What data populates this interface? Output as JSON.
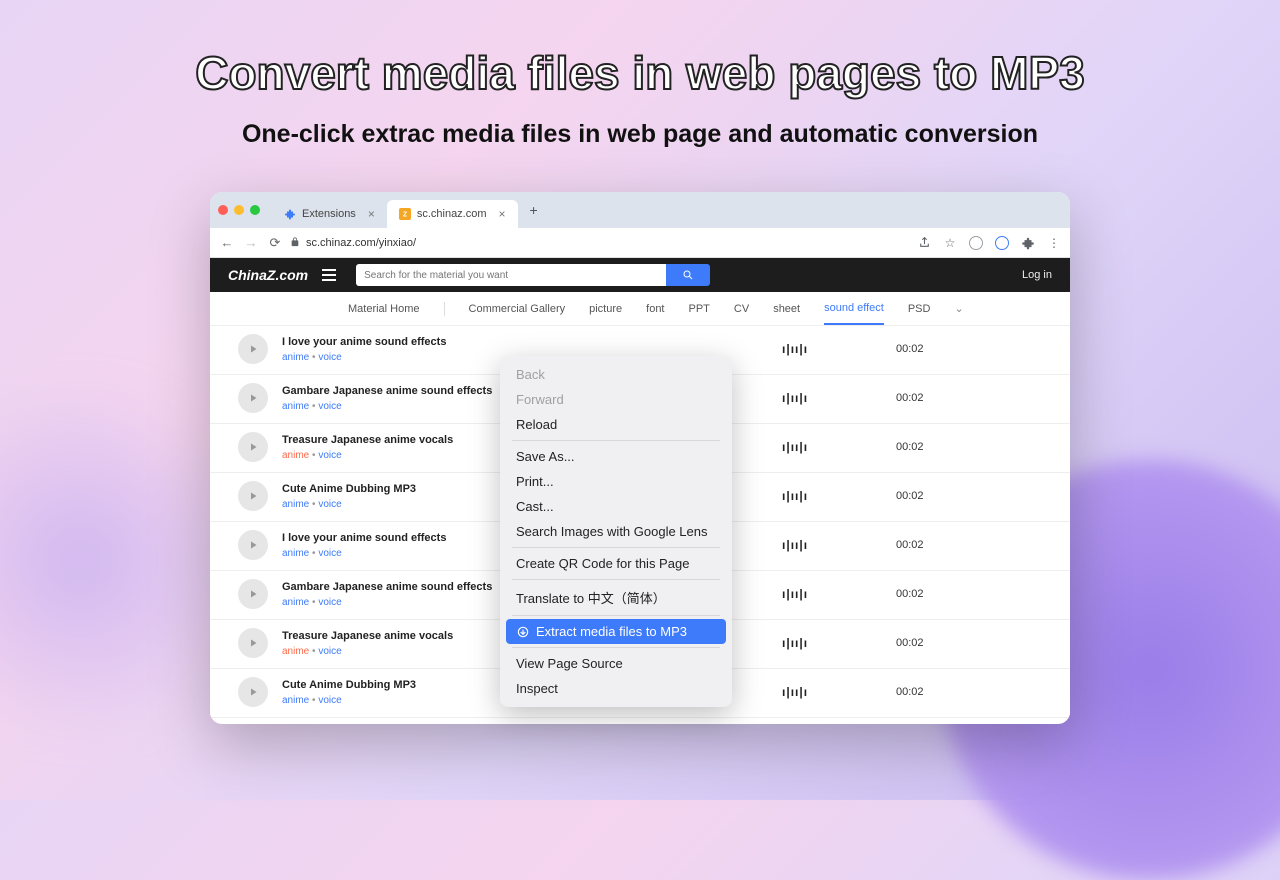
{
  "promo": {
    "headline": "Convert media files in web pages to MP3",
    "subheadline": "One-click extrac media files in web page and automatic conversion"
  },
  "browser": {
    "tabs": [
      {
        "title": "Extensions",
        "active": false
      },
      {
        "title": "sc.chinaz.com",
        "active": true
      }
    ],
    "newtab_label": "+",
    "url": "sc.chinaz.com/yinxiao/"
  },
  "site": {
    "logo": "ChinaZ.com",
    "search_placeholder": "Search for the material you want",
    "login_label": "Log in",
    "nav": [
      {
        "label": "Material Home"
      },
      {
        "label": "Commercial Gallery"
      },
      {
        "label": "picture"
      },
      {
        "label": "font"
      },
      {
        "label": "PPT"
      },
      {
        "label": "CV"
      },
      {
        "label": "sheet"
      },
      {
        "label": "sound effect",
        "active": true
      },
      {
        "label": "PSD"
      }
    ],
    "list": [
      {
        "title": "I love your anime sound effects",
        "tag1": "anime",
        "tag2": "voice",
        "hot": false,
        "duration": "00:02"
      },
      {
        "title": "Gambare Japanese anime sound effects",
        "tag1": "anime",
        "tag2": "voice",
        "hot": false,
        "duration": "00:02"
      },
      {
        "title": "Treasure Japanese anime vocals",
        "tag1": "anime",
        "tag2": "voice",
        "hot": true,
        "duration": "00:02"
      },
      {
        "title": "Cute Anime Dubbing MP3",
        "tag1": "anime",
        "tag2": "voice",
        "hot": false,
        "duration": "00:02"
      },
      {
        "title": "I love your anime sound effects",
        "tag1": "anime",
        "tag2": "voice",
        "hot": false,
        "duration": "00:02"
      },
      {
        "title": "Gambare Japanese anime sound effects",
        "tag1": "anime",
        "tag2": "voice",
        "hot": false,
        "duration": "00:02"
      },
      {
        "title": "Treasure Japanese anime vocals",
        "tag1": "anime",
        "tag2": "voice",
        "hot": true,
        "duration": "00:02"
      },
      {
        "title": "Cute Anime Dubbing MP3",
        "tag1": "anime",
        "tag2": "voice",
        "hot": false,
        "duration": "00:02"
      }
    ]
  },
  "context_menu": {
    "back": "Back",
    "forward": "Forward",
    "reload": "Reload",
    "save_as": "Save As...",
    "print": "Print...",
    "cast": "Cast...",
    "lens": "Search Images with Google Lens",
    "qr": "Create QR Code for this Page",
    "translate": "Translate to 中文（简体）",
    "extract": "Extract media files to MP3",
    "view_source": "View Page Source",
    "inspect": "Inspect"
  }
}
